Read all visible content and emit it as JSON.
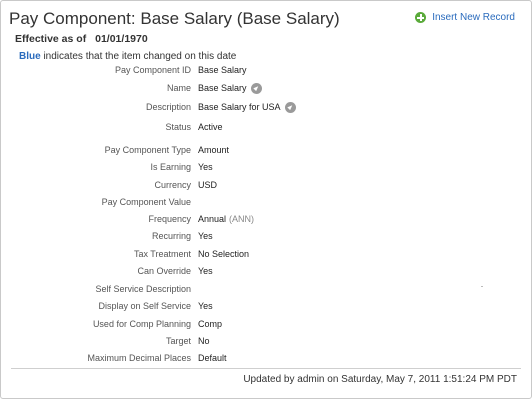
{
  "header": {
    "title": "Pay Component: Base Salary (Base Salary)",
    "insert_label": "Insert New Record"
  },
  "effective": {
    "label": "Effective as of",
    "date": "01/01/1970"
  },
  "legend": {
    "blue_word": "Blue",
    "text": " indicates that the item changed on this date"
  },
  "fields": [
    {
      "label": "Pay Component ID",
      "value": "Base Salary",
      "sub": "",
      "info": false
    },
    {
      "label": "Name",
      "value": "Base Salary",
      "sub": "",
      "info": true
    },
    {
      "label": "Description",
      "value": "Base Salary for USA",
      "sub": "",
      "info": true
    },
    {
      "label": "Status",
      "value": "Active",
      "sub": "",
      "info": false
    },
    {
      "label": "Pay Component Type",
      "value": "Amount",
      "sub": "",
      "info": false
    },
    {
      "label": "Is Earning",
      "value": "Yes",
      "sub": "",
      "info": false
    },
    {
      "label": "Currency",
      "value": "USD",
      "sub": "",
      "info": false
    },
    {
      "label": "Pay Component Value",
      "value": "",
      "sub": "",
      "info": false
    },
    {
      "label": "Frequency",
      "value": "Annual",
      "sub": "(ANN)",
      "info": false
    },
    {
      "label": "Recurring",
      "value": "Yes",
      "sub": "",
      "info": false
    },
    {
      "label": "Tax Treatment",
      "value": "No Selection",
      "sub": "",
      "info": false
    },
    {
      "label": "Can Override",
      "value": "Yes",
      "sub": "",
      "info": false
    },
    {
      "label": "Self Service Description",
      "value": "",
      "sub": "",
      "info": false
    },
    {
      "label": "Display on Self Service",
      "value": "Yes",
      "sub": "",
      "info": false
    },
    {
      "label": "Used for Comp Planning",
      "value": "Comp",
      "sub": "",
      "info": false
    },
    {
      "label": "Target",
      "value": "No",
      "sub": "",
      "info": false
    },
    {
      "label": "Maximum Decimal Places",
      "value": "Default",
      "sub": "",
      "info": false
    }
  ],
  "footer": {
    "updated_text": "Updated by admin on Saturday, May 7, 2011 1:51:24 PM PDT"
  },
  "icons": {
    "insert": "plus-circle-icon",
    "info": "info-arrow-icon"
  },
  "colors": {
    "link": "#2a6bbd",
    "add_icon": "#5aaa3a"
  }
}
